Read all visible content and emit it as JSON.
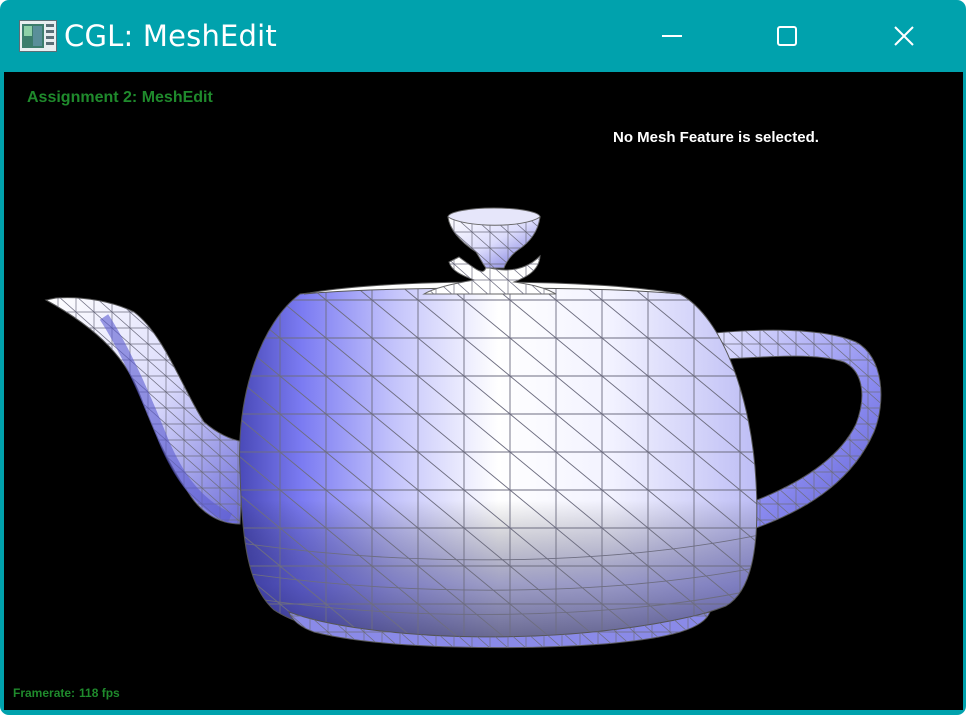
{
  "window": {
    "title": "CGL: MeshEdit",
    "controls": [
      "minimize",
      "maximize",
      "close"
    ],
    "colors": {
      "frame": "#00a2ad",
      "viewport": "#000000",
      "hud_text": "#1f8a2c",
      "mesh_light": "#ffffff",
      "mesh_dark": "#7b7bf2"
    }
  },
  "viewport": {
    "assignment_label": "Assignment 2: MeshEdit",
    "selection_status": "No Mesh Feature is selected.",
    "framerate_label": "Framerate:",
    "framerate_value": "118 fps",
    "model": "teapot-mesh"
  }
}
